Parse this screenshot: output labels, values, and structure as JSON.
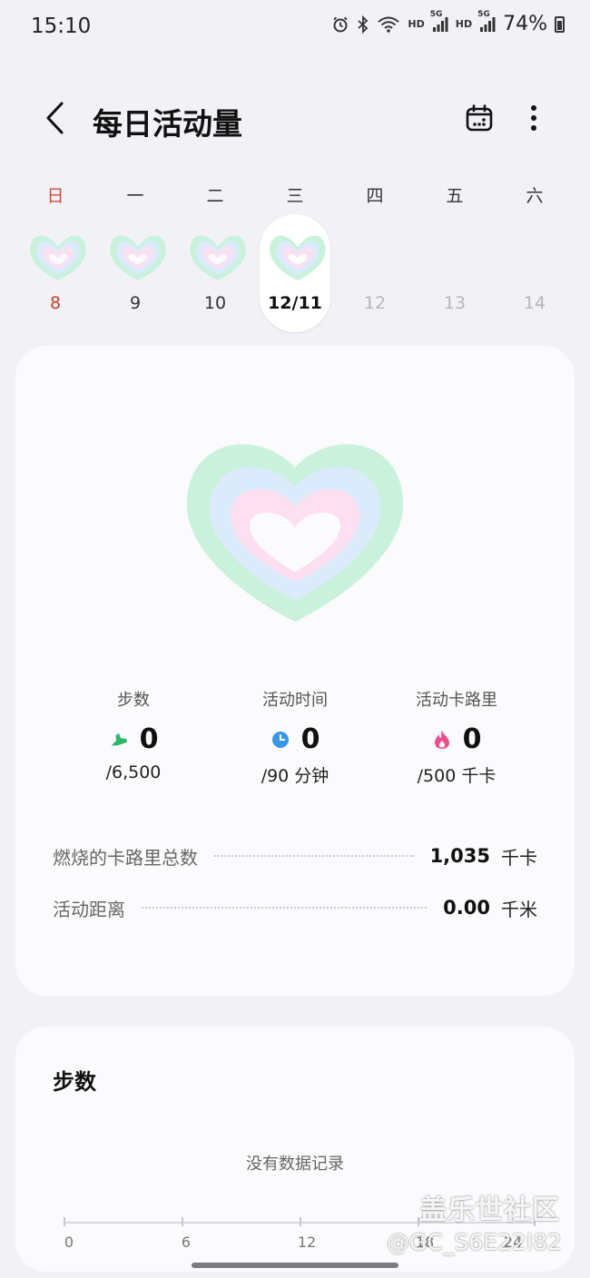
{
  "status_bar": {
    "time": "15:10",
    "battery": "74%",
    "network_labels": [
      "HD",
      "5G",
      "HD",
      "5G"
    ],
    "icons": [
      "alarm-icon",
      "bluetooth-icon",
      "wifi-icon",
      "signal-icon",
      "signal-icon",
      "battery-icon"
    ]
  },
  "header": {
    "title": "每日活动量",
    "back_icon": "chevron-left-icon",
    "calendar_icon": "calendar-icon",
    "more_icon": "more-vertical-icon"
  },
  "week": {
    "days": [
      {
        "label": "日",
        "date": "8",
        "has_heart": true,
        "sunday": true,
        "selected": false,
        "future": false
      },
      {
        "label": "一",
        "date": "9",
        "has_heart": true,
        "sunday": false,
        "selected": false,
        "future": false
      },
      {
        "label": "二",
        "date": "10",
        "has_heart": true,
        "sunday": false,
        "selected": false,
        "future": false
      },
      {
        "label": "三",
        "date": "12/11",
        "has_heart": true,
        "sunday": false,
        "selected": true,
        "future": false
      },
      {
        "label": "四",
        "date": "12",
        "has_heart": false,
        "sunday": false,
        "selected": false,
        "future": true
      },
      {
        "label": "五",
        "date": "13",
        "has_heart": false,
        "sunday": false,
        "selected": false,
        "future": true
      },
      {
        "label": "六",
        "date": "14",
        "has_heart": false,
        "sunday": false,
        "selected": false,
        "future": true
      }
    ]
  },
  "summary": {
    "stats": [
      {
        "label": "步数",
        "value": "0",
        "goal": "/6,500",
        "icon": "shoe-icon",
        "color": "#2fb86a"
      },
      {
        "label": "活动时间",
        "value": "0",
        "goal": "/90 分钟",
        "icon": "clock-icon",
        "color": "#3a97e6"
      },
      {
        "label": "活动卡路里",
        "value": "0",
        "goal": "/500 千卡",
        "icon": "flame-icon",
        "color": "#e8508f"
      }
    ],
    "metrics": [
      {
        "label": "燃烧的卡路里总数",
        "value": "1,035",
        "unit": "千卡"
      },
      {
        "label": "活动距离",
        "value": "0.00",
        "unit": "千米"
      }
    ],
    "ring_colors": {
      "outer": "#c9f1dc",
      "middle": "#dcebfb",
      "inner": "#fcdff0"
    }
  },
  "steps_chart": {
    "title": "步数",
    "empty_text": "没有数据记录",
    "tick_labels": [
      "0",
      "6",
      "12",
      "18",
      "24"
    ]
  },
  "watermark": {
    "line1": "盖乐世社区",
    "line2": "@GC_S6E22I82"
  }
}
